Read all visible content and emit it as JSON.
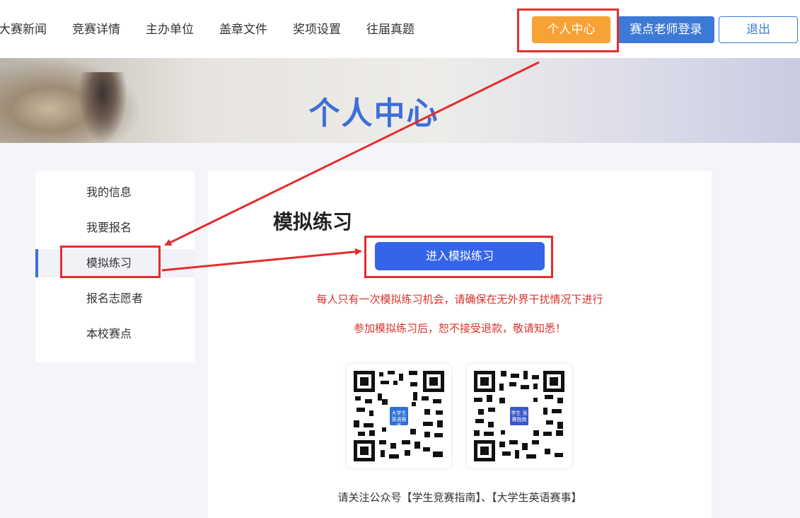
{
  "header": {
    "nav": [
      "大赛新闻",
      "竞赛详情",
      "主办单位",
      "盖章文件",
      "奖项设置",
      "往届真题"
    ],
    "center_btn": "个人中心",
    "teacher_btn": "赛点老师登录",
    "logout_btn": "退出"
  },
  "banner": {
    "title": "个人中心"
  },
  "sidebar": {
    "items": [
      {
        "label": "我的信息"
      },
      {
        "label": "我要报名"
      },
      {
        "label": "模拟练习"
      },
      {
        "label": "报名志愿者"
      },
      {
        "label": "本校赛点"
      }
    ],
    "active": "模拟练习"
  },
  "main": {
    "title": "模拟练习",
    "enter_btn": "进入模拟练习",
    "notice1": "每人只有一次模拟练习机会，请确保在无外界干扰情况下进行",
    "notice2": "参加模拟练习后，恕不接受退款，敬请知悉！",
    "qr1_logo": "大学生 英语赛事",
    "qr2_logo": "学生 竞赛指南",
    "follow_text": "请关注公众号【学生竞赛指南】、【大学生英语赛事】"
  },
  "colors": {
    "accent": "#3564e8",
    "orange": "#f7a234",
    "teacher_blue": "#3d7ad6",
    "notice_red": "#d8332c",
    "annotation_red": "#e52c2c"
  }
}
